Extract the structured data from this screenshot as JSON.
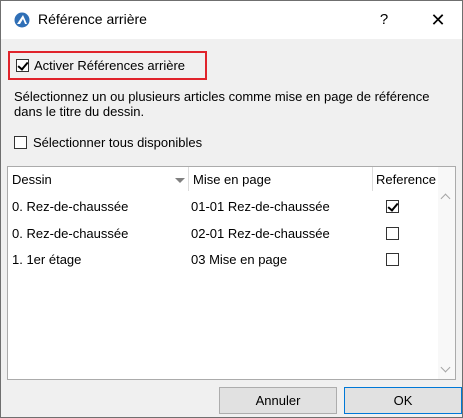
{
  "window": {
    "title": "Référence arrière",
    "help_label": "?",
    "close_label": "✕"
  },
  "activate": {
    "label": "Activer Références arrière",
    "checked": true
  },
  "description": "Sélectionnez un ou plusieurs articles comme mise en page de référence dans le titre du dessin.",
  "select_all": {
    "label": "Sélectionner tous disponibles",
    "checked": false
  },
  "table": {
    "headers": [
      "Dessin",
      "Mise en page",
      "Reference"
    ],
    "rows": [
      {
        "dessin": "0. Rez-de-chaussée",
        "mise_en_page": "01-01 Rez-de-chaussée",
        "reference": true
      },
      {
        "dessin": "0. Rez-de-chaussée",
        "mise_en_page": "02-01 Rez-de-chaussée",
        "reference": false
      },
      {
        "dessin": "1. 1er étage",
        "mise_en_page": "03 Mise en page",
        "reference": false
      }
    ]
  },
  "buttons": {
    "cancel": "Annuler",
    "ok": "OK"
  },
  "colors": {
    "highlight_border": "#e0232b",
    "dialog_bg": "#f0f0f0",
    "ok_border": "#0078d7"
  }
}
